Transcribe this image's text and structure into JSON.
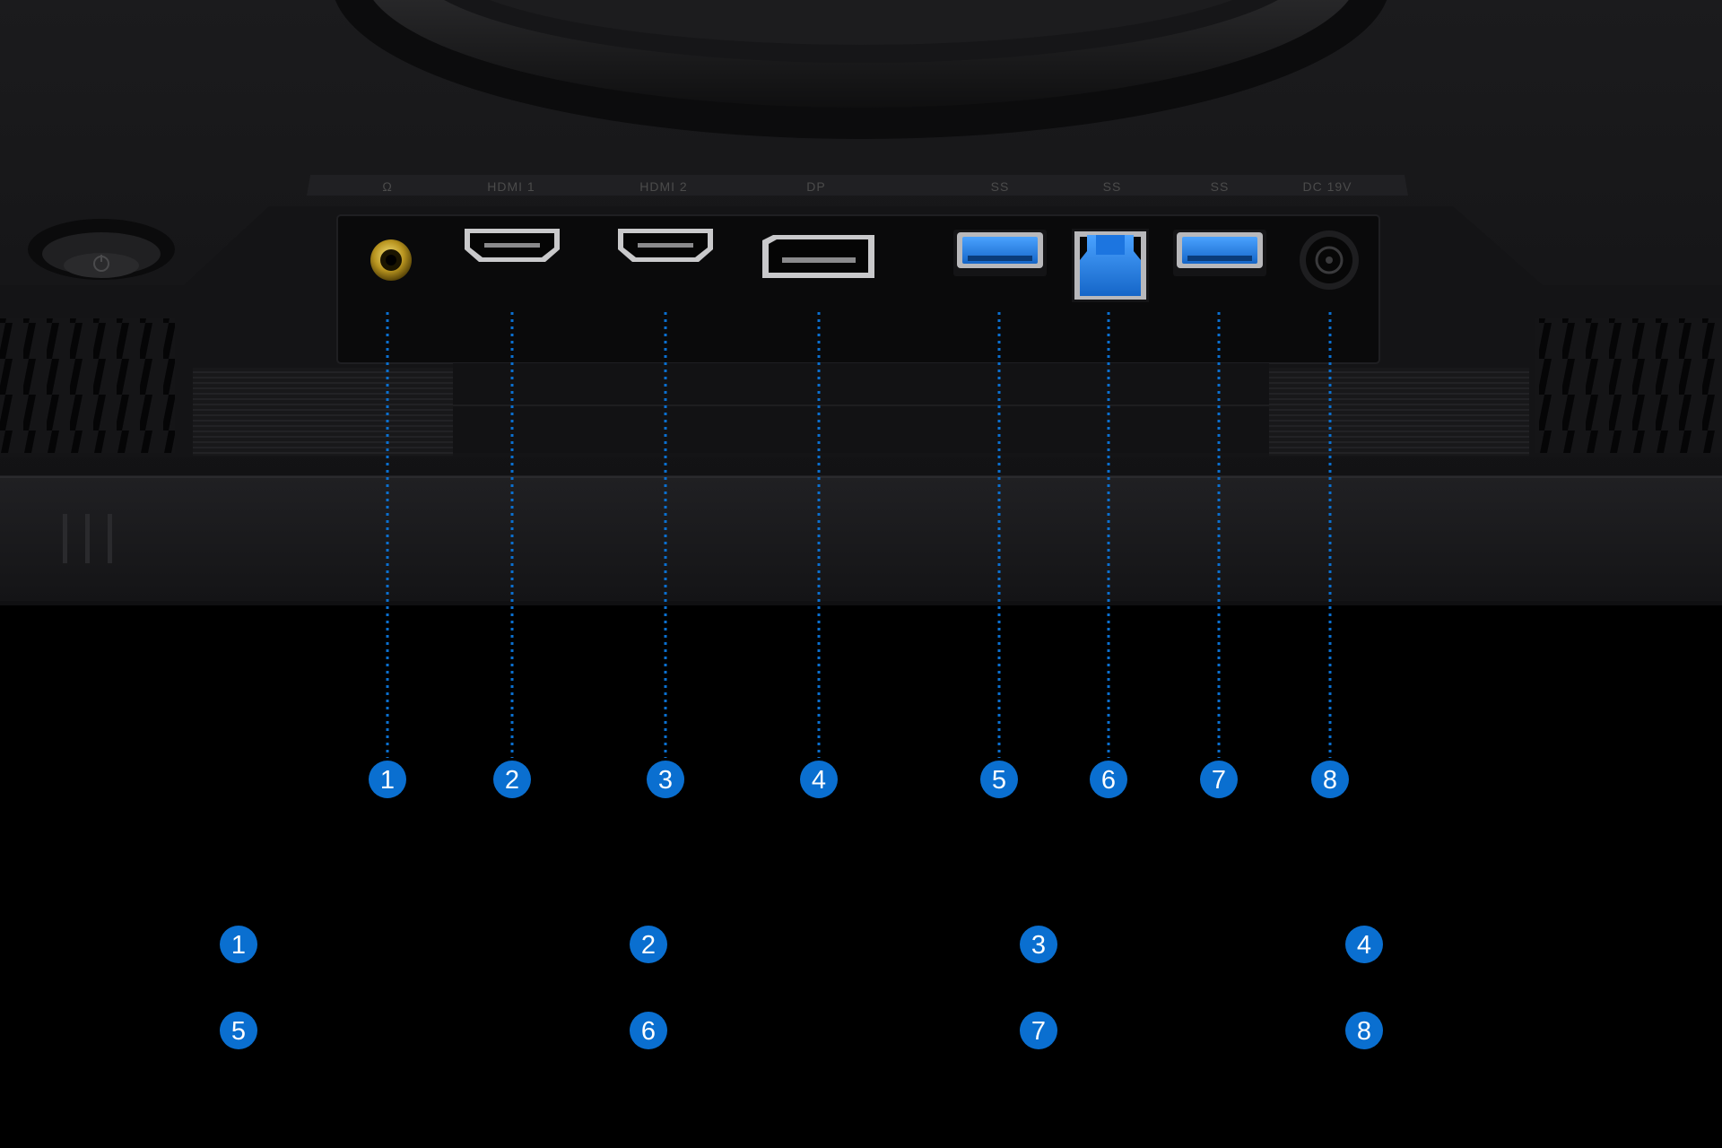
{
  "accent_color": "#0a6fd0",
  "port_panel": {
    "silkscreen_labels": [
      "HDMI 1",
      "HDMI 2",
      "DP",
      "DC 19V"
    ],
    "ports": [
      {
        "number": "1",
        "icon": "headphone-jack-icon"
      },
      {
        "number": "2",
        "icon": "hdmi-port-icon"
      },
      {
        "number": "3",
        "icon": "hdmi-port-icon"
      },
      {
        "number": "4",
        "icon": "displayport-icon"
      },
      {
        "number": "5",
        "icon": "usb-a-port-icon"
      },
      {
        "number": "6",
        "icon": "usb-b-port-icon"
      },
      {
        "number": "7",
        "icon": "usb-a-port-icon"
      },
      {
        "number": "8",
        "icon": "dc-power-jack-icon"
      }
    ]
  },
  "legend": {
    "items": [
      "1",
      "2",
      "3",
      "4",
      "5",
      "6",
      "7",
      "8"
    ]
  }
}
